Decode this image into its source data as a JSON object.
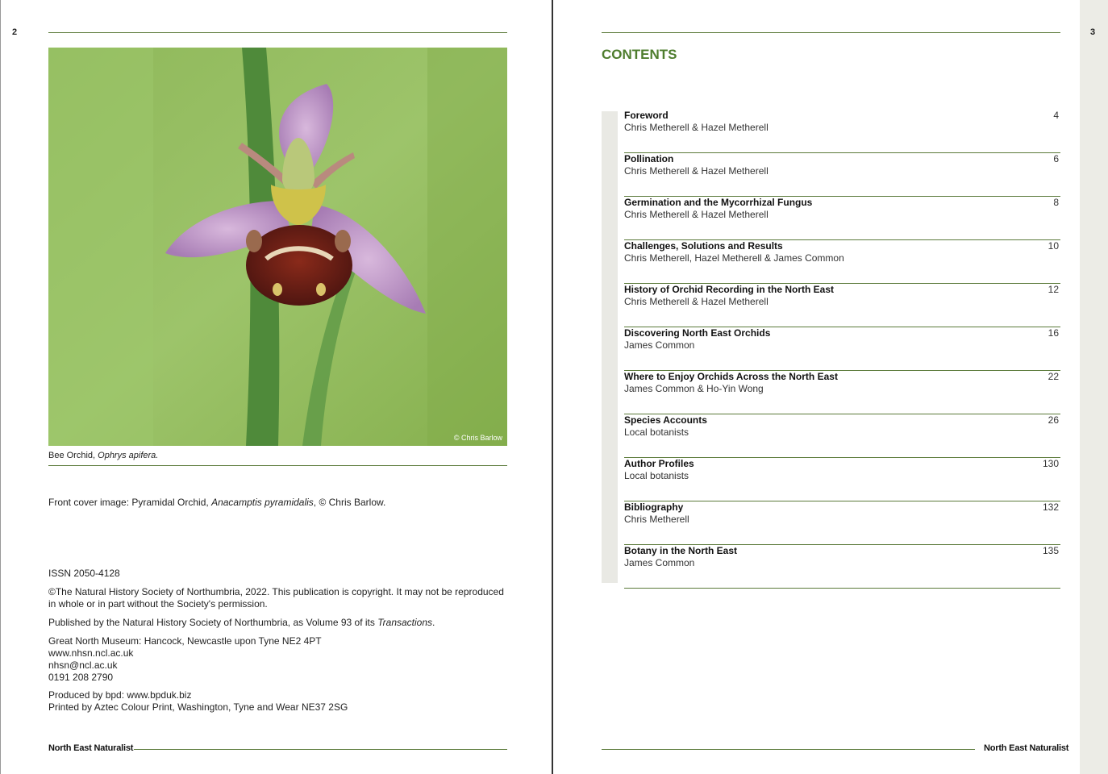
{
  "left_page": {
    "page_number": "2",
    "photo": {
      "subject": "Bee Orchid photograph",
      "credit": "© Chris Barlow"
    },
    "caption": {
      "common": "Bee Orchid, ",
      "latin": "Ophrys apifera."
    },
    "front_cover": {
      "prefix": "Front cover image: Pyramidal Orchid, ",
      "latin": "Anacamptis pyramidalis",
      "suffix": ", © Chris Barlow."
    },
    "issn": "ISSN 2050-4128",
    "copyright": "©The Natural History Society of Northumbria, 2022. This publication is copyright. It may not be reproduced in whole or in part without the Society's permission.",
    "published": {
      "prefix": "Published by the Natural History Society of Northumbria, as Volume 93 of its ",
      "italic": "Transactions",
      "suffix": "."
    },
    "address": [
      "Great North Museum: Hancock, Newcastle upon Tyne NE2 4PT",
      "www.nhsn.ncl.ac.uk",
      "nhsn@ncl.ac.uk",
      "0191 208 2790"
    ],
    "production": [
      "Produced by bpd: www.bpduk.biz",
      "Printed by Aztec Colour Print, Washington, Tyne and Wear NE37 2SG"
    ],
    "footer_title": "North East Naturalist"
  },
  "right_page": {
    "page_number": "3",
    "heading": "CONTENTS",
    "toc": [
      {
        "title": "Foreword",
        "author": "Chris Metherell & Hazel Metherell",
        "page": "4"
      },
      {
        "title": "Pollination",
        "author": "Chris Metherell & Hazel Metherell",
        "page": "6"
      },
      {
        "title": "Germination and the Mycorrhizal Fungus",
        "author": "Chris Metherell & Hazel Metherell",
        "page": "8"
      },
      {
        "title": "Challenges, Solutions and Results",
        "author": "Chris Metherell, Hazel Metherell & James Common",
        "page": "10"
      },
      {
        "title": "History of Orchid Recording in the North East",
        "author": "Chris Metherell & Hazel Metherell",
        "page": "12"
      },
      {
        "title": "Discovering North East Orchids",
        "author": "James Common",
        "page": "16"
      },
      {
        "title": "Where to Enjoy Orchids Across the North East",
        "author": "James Common & Ho-Yin Wong",
        "page": "22"
      },
      {
        "title": "Species Accounts",
        "author": "Local botanists",
        "page": "26"
      },
      {
        "title": "Author Profiles",
        "author": "Local botanists",
        "page": "130"
      },
      {
        "title": "Bibliography",
        "author": "Chris Metherell",
        "page": "132"
      },
      {
        "title": "Botany in the North East",
        "author": "James Common",
        "page": "135"
      }
    ],
    "footer_title": "North East Naturalist"
  },
  "colors": {
    "accent_green": "#4e7d2e",
    "rule_green": "#5b7a3a",
    "strip_grey": "#ecece6"
  }
}
